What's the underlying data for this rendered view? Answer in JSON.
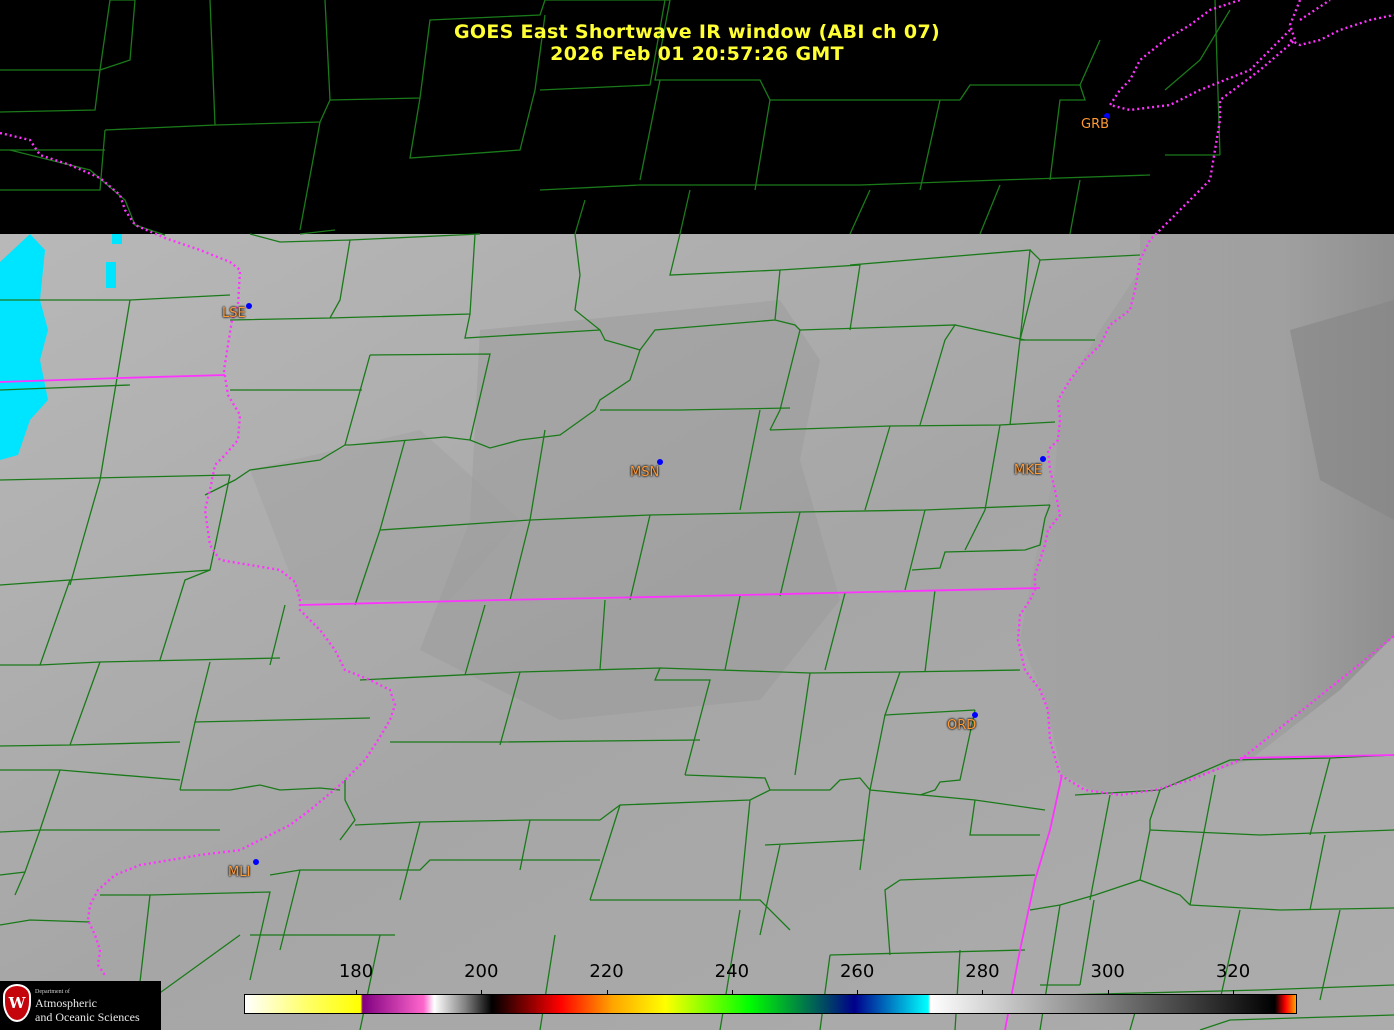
{
  "title": {
    "line1": "GOES East Shortwave IR window (ABI ch 07)",
    "line2": "2026 Feb 01  20:57:26 GMT"
  },
  "stations": [
    {
      "code": "GRB"
    },
    {
      "code": "LSE"
    },
    {
      "code": "MSN"
    },
    {
      "code": "MKE"
    },
    {
      "code": "ORD"
    },
    {
      "code": "MLI"
    }
  ],
  "colorbar": {
    "ticks": [
      "180",
      "200",
      "220",
      "240",
      "260",
      "280",
      "300",
      "320"
    ],
    "colors": [
      "#ffffff",
      "#ffff00",
      "#800080",
      "#ff66cc",
      "#ffffff",
      "#000000",
      "#ff0000",
      "#ffa500",
      "#ffff00",
      "#00ff00",
      "#00008b",
      "#00ffff",
      "#ffffff",
      "#000000",
      "#ff0000",
      "#ffa500"
    ]
  },
  "logo": {
    "dept": "Department of",
    "line1": "Atmospheric",
    "line2": "and Oceanic Sciences"
  },
  "colors": {
    "county_lines": "#1a7a1a",
    "state_lines": "#ff33ff",
    "title": "#ffff33",
    "station_label": "#ff9933",
    "station_dot": "#0000ff",
    "cold_cloud": "#00e5ff"
  }
}
